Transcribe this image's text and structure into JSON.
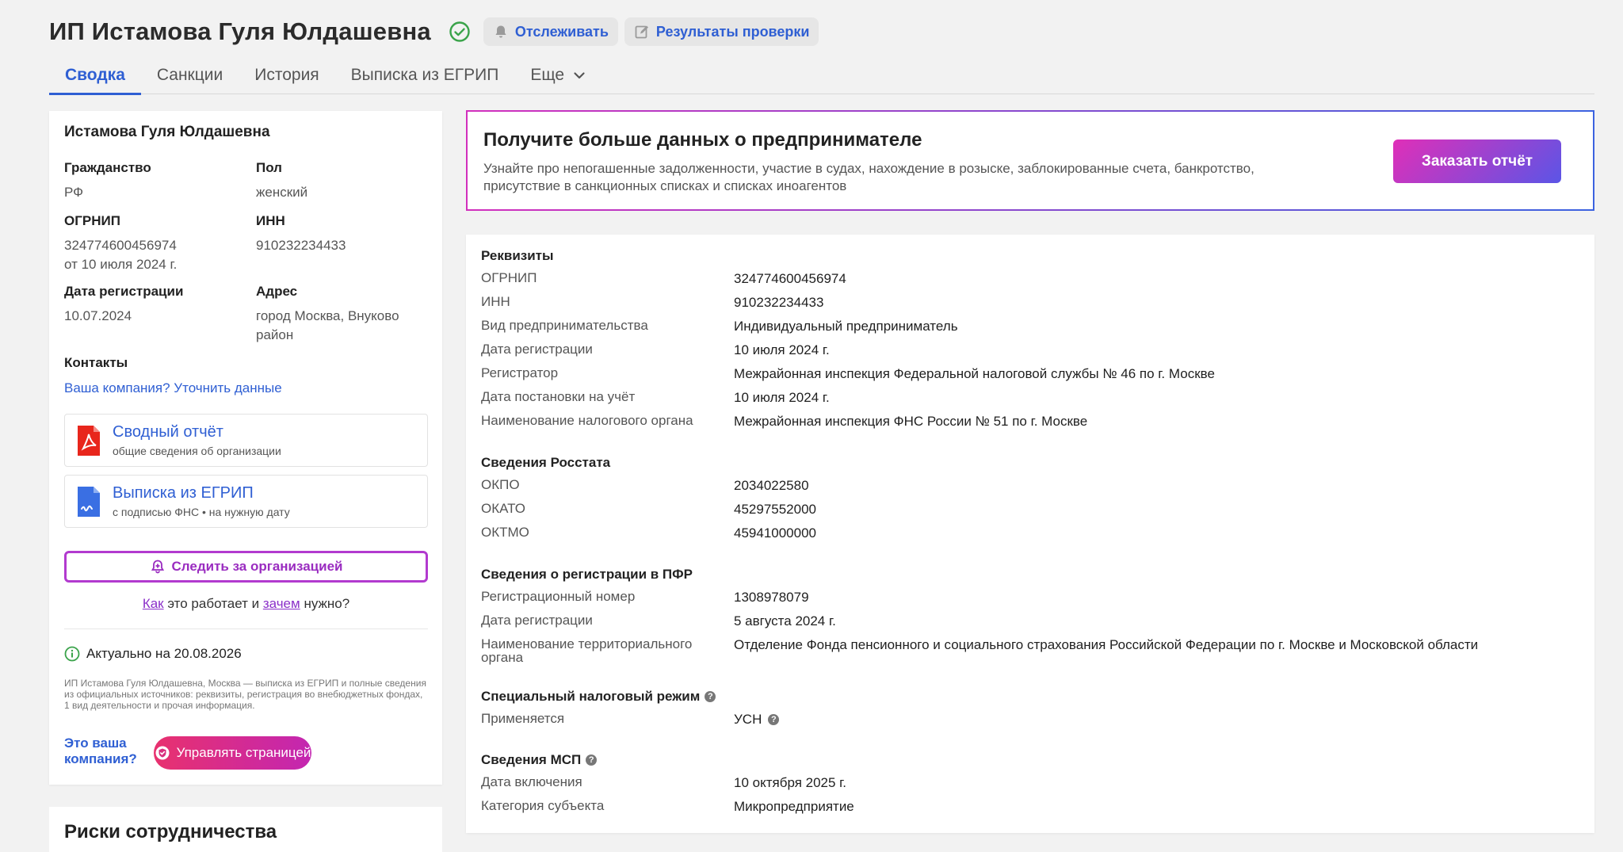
{
  "header": {
    "title": "ИП Истамова Гуля Юлдашевна",
    "track_button": "Отслеживать",
    "results_button": "Результаты проверки"
  },
  "tabs": [
    {
      "label": "Сводка"
    },
    {
      "label": "Санкции"
    },
    {
      "label": "История"
    },
    {
      "label": "Выписка из ЕГРИП"
    },
    {
      "label": "Еще"
    }
  ],
  "summary": {
    "name": "Истамова Гуля Юлдашевна",
    "citizenship_label": "Гражданство",
    "citizenship": "РФ",
    "sex_label": "Пол",
    "sex": "женский",
    "ogrnip_label": "ОГРНИП",
    "ogrnip": "324774600456974",
    "ogrnip_date": "от 10 июля 2024 г.",
    "inn_label": "ИНН",
    "inn": "910232234433",
    "reg_date_label": "Дата регистрации",
    "reg_date": "10.07.2024",
    "address_label": "Адрес",
    "address_line1": "город Москва, Внуково",
    "address_line2": "район",
    "contacts_label": "Контакты",
    "contacts_link": "Ваша компания? Уточнить данные",
    "report_title": "Сводный отчёт",
    "report_sub": "общие сведения об организации",
    "extract_title": "Выписка из ЕГРИП",
    "extract_sub": "с подписью ФНС • на нужную дату",
    "follow_button": "Следить за организацией",
    "how_link": "Как",
    "how_mid": "это работает и",
    "why_link": "зачем",
    "how_end": "нужно?",
    "actual": "Актуально на 20.08.2026",
    "fine_print": "ИП Истамова Гуля Юлдашевна, Москва — выписка из ЕГРИП и полные сведения из официальных источников: реквизиты, регистрация во внебюджетных фондах, 1 вид деятельности и прочая информация.",
    "your_company_1": "Это ваша",
    "your_company_2": "компания?",
    "manage_button": "Управлять страницей"
  },
  "risks": {
    "title": "Риски сотрудничества"
  },
  "promo": {
    "title": "Получите больше данных о предпринимателе",
    "text": "Узнайте про непогашенные задолженности, участие в судах, нахождение в розыске, заблокированные счета, банкротство, присутствие в санкционных списках и списках иноагентов",
    "button": "Заказать отчёт"
  },
  "details": {
    "requisites_title": "Реквизиты",
    "requisites": [
      {
        "k": "ОГРНИП",
        "v": "324774600456974"
      },
      {
        "k": "ИНН",
        "v": "910232234433"
      },
      {
        "k": "Вид предпринимательства",
        "v": "Индивидуальный предприниматель"
      },
      {
        "k": "Дата регистрации",
        "v": "10 июля 2024 г."
      },
      {
        "k": "Регистратор",
        "v": "Межрайонная инспекция Федеральной налоговой службы № 46 по г. Москве"
      },
      {
        "k": "Дата постановки на учёт",
        "v": "10 июля 2024 г."
      },
      {
        "k": "Наименование налогового органа",
        "v": "Межрайонная инспекция ФНС России № 51 по г. Москве"
      }
    ],
    "rosstat_title": "Сведения Росстата",
    "rosstat": [
      {
        "k": "ОКПО",
        "v": "2034022580"
      },
      {
        "k": "ОКАТО",
        "v": "45297552000"
      },
      {
        "k": "ОКТМО",
        "v": "45941000000"
      }
    ],
    "pfr_title": "Сведения о регистрации в ПФР",
    "pfr": [
      {
        "k": "Регистрационный номер",
        "v": "1308978079"
      },
      {
        "k": "Дата регистрации",
        "v": "5 августа 2024 г."
      },
      {
        "k": "Наименование территориального органа",
        "v": "Отделение Фонда пенсионного и социального страхования Российской Федерации по г. Москве и Московской области"
      }
    ],
    "tax_title": "Специальный налоговый режим",
    "tax": [
      {
        "k": "Применяется",
        "v": "УСН"
      }
    ],
    "msp_title": "Сведения МСП",
    "msp": [
      {
        "k": "Дата включения",
        "v": "10 октября 2025 г."
      },
      {
        "k": "Категория субъекта",
        "v": "Микропредприятие"
      }
    ],
    "help_glyph": "?"
  },
  "colors": {
    "accent": "#2f5fd3",
    "purple": "#b23acf",
    "green": "#3aa34a"
  }
}
